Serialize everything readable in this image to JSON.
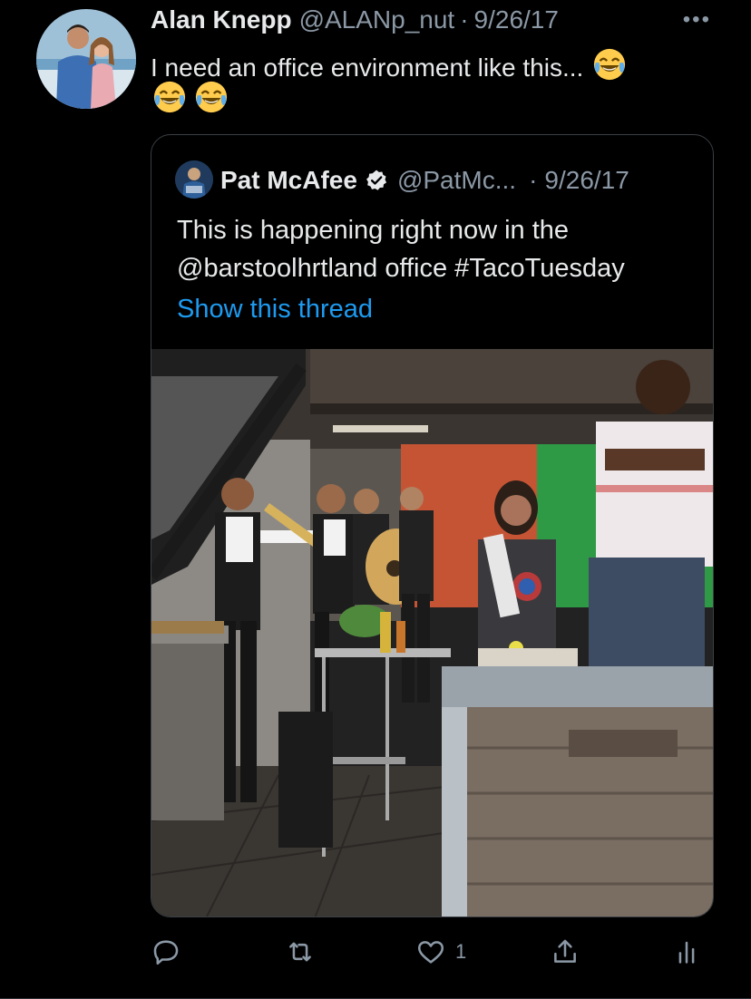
{
  "tweet": {
    "author_name": "Alan Knepp",
    "author_handle": "@ALANp_nut",
    "separator": "·",
    "date": "9/26/17",
    "text": "I need an office environment like this...",
    "emojis": [
      "face-with-tears-of-joy",
      "face-with-tears-of-joy",
      "face-with-tears-of-joy"
    ],
    "more_icon": "more-horizontal-icon"
  },
  "quoted_tweet": {
    "author_name": "Pat McAfee",
    "verified": true,
    "author_handle": "@PatMc...",
    "separator": "·",
    "date": "9/26/17",
    "text_line1": "This is happening right now in the",
    "text_line2": "@barstoolhrtland office #TacoTuesday",
    "show_thread_label": "Show this thread",
    "media_description_icon": "video-still"
  },
  "actions": {
    "reply_icon": "reply-icon",
    "retweet_icon": "retweet-icon",
    "like_icon": "heart-icon",
    "like_count": "1",
    "share_icon": "share-icon",
    "analytics_icon": "analytics-icon"
  },
  "colors": {
    "background": "#000000",
    "text_primary": "#e7e9ea",
    "text_secondary": "#8b98a5",
    "link": "#1d9bf0",
    "border": "#3a3f44"
  }
}
